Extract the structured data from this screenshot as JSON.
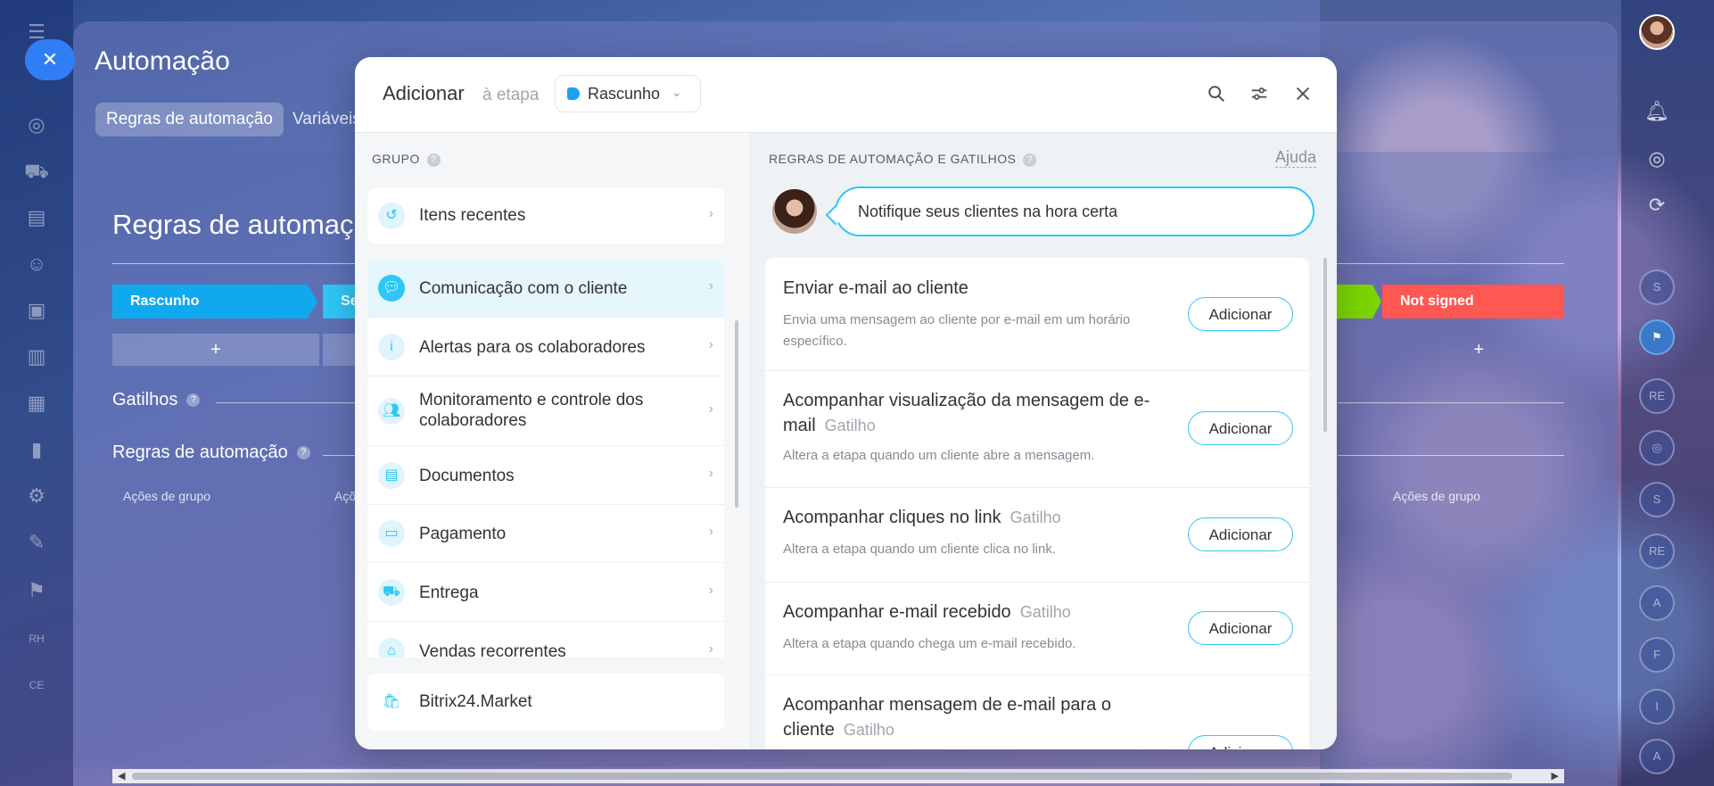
{
  "background": {
    "title": "Automação",
    "tabs": [
      "Regras de automação",
      "Variáveis"
    ],
    "heading": "Regras de automaç",
    "stages": [
      {
        "label": "Rascunho",
        "color": "#10a9f0"
      },
      {
        "label": "Se",
        "color": "#2fc6f6"
      },
      {
        "label": "",
        "color": "#7bd500"
      },
      {
        "label": "Not signed",
        "color": "#ff5752"
      }
    ],
    "plus": "+",
    "triggers_label": "Gatilhos",
    "rules_label": "Regras de automação",
    "group_actions": [
      "Ações de grupo",
      "Açõ",
      "Ações de grupo"
    ]
  },
  "modal": {
    "title": "Adicionar",
    "subtitle": "à etapa",
    "stage_select": {
      "value": "Rascunho",
      "color": "#1ba1f2"
    },
    "icons": [
      "search-icon",
      "filter-icon",
      "close-icon"
    ]
  },
  "left_panel": {
    "title": "GRUPO",
    "recent": "Itens recentes",
    "groups": [
      {
        "label": "Comunicação com o cliente",
        "icon": "chat-icon"
      },
      {
        "label": "Alertas para os colaboradores",
        "icon": "info-icon"
      },
      {
        "label": "Monitoramento e controle dos colaboradores",
        "icon": "people-icon"
      },
      {
        "label": "Documentos",
        "icon": "document-icon"
      },
      {
        "label": "Pagamento",
        "icon": "wallet-icon"
      },
      {
        "label": "Entrega",
        "icon": "truck-icon"
      },
      {
        "label": "Vendas recorrentes",
        "icon": "basket-icon"
      }
    ],
    "market": "Bitrix24.Market"
  },
  "right_panel": {
    "title": "REGRAS DE AUTOMAÇÃO E GATILHOS",
    "help": "Ajuda",
    "bubble": "Notifique seus clientes na hora certa",
    "add_label": "Adicionar",
    "rules": [
      {
        "title": "Enviar e-mail ao cliente",
        "trigger": "",
        "desc": "Envia uma mensagem ao cliente por e-mail em um horário específico."
      },
      {
        "title": "Acompanhar visualização da mensagem de e-mail",
        "trigger": "Gatilho",
        "desc": "Altera a etapa quando um cliente abre a mensagem."
      },
      {
        "title": "Acompanhar cliques no link",
        "trigger": "Gatilho",
        "desc": "Altera a etapa quando um cliente clica no link."
      },
      {
        "title": "Acompanhar e-mail recebido",
        "trigger": "Gatilho",
        "desc": "Altera a etapa quando chega um e-mail recebido."
      },
      {
        "title": "Acompanhar mensagem de e-mail para o cliente",
        "trigger": "Gatilho",
        "desc": ""
      }
    ]
  },
  "right_rail": {
    "avatars": [
      "S",
      "RE",
      "S",
      "RE",
      "A",
      "F",
      "I",
      "A"
    ]
  },
  "left_nav_labels": [
    "RH",
    "CE"
  ],
  "colors": {
    "accent": "#2fc6f6",
    "fab": "#2f7ef5"
  }
}
